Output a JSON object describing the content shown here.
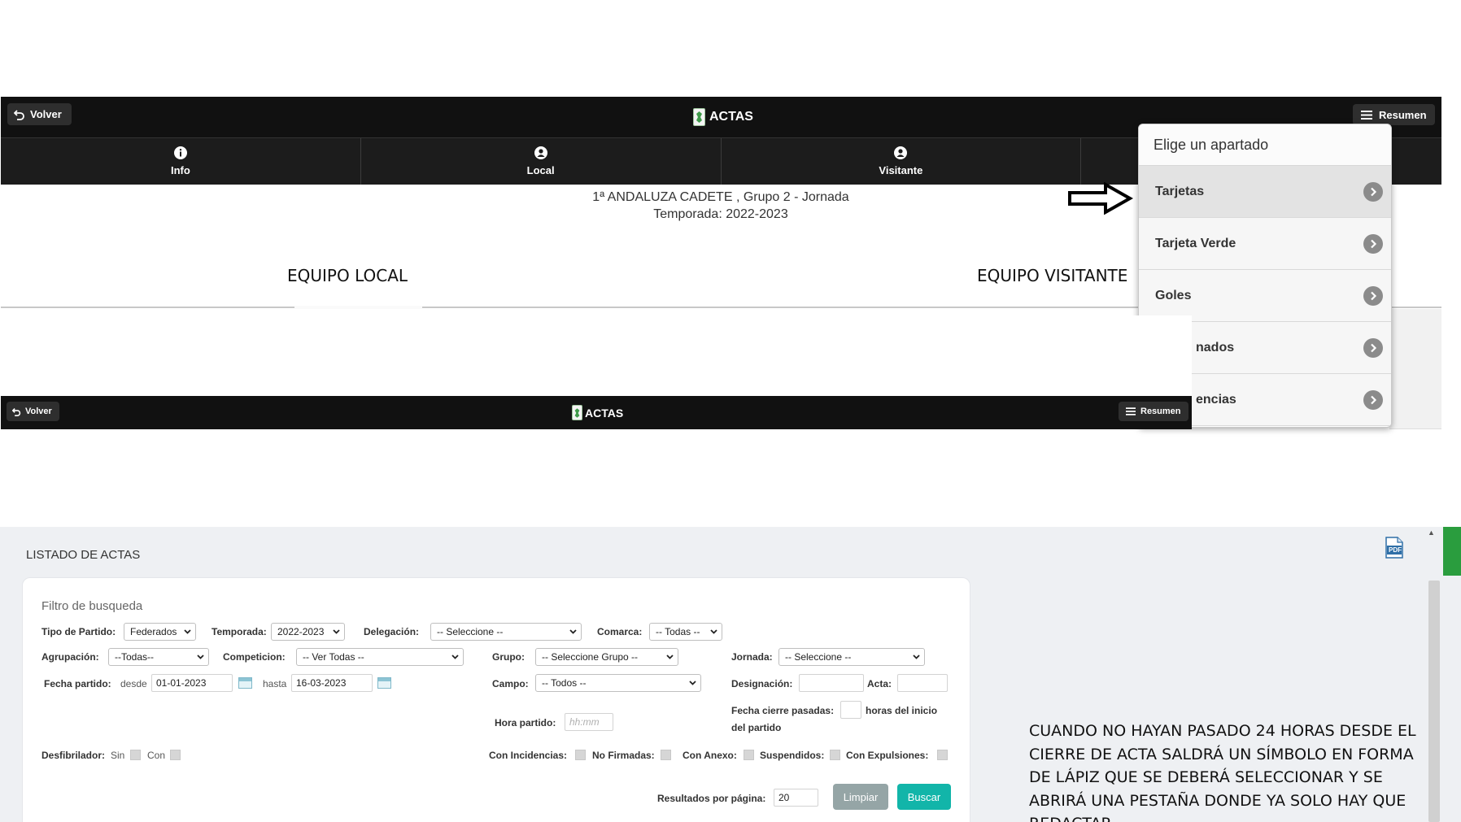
{
  "app": {
    "back_label": "Volver",
    "title": "ACTAS",
    "summary_label": "Resumen"
  },
  "tabs": [
    {
      "label": "Info",
      "icon": "info-icon"
    },
    {
      "label": "Local",
      "icon": "user-icon"
    },
    {
      "label": "Visitante",
      "icon": "user-icon"
    }
  ],
  "match": {
    "competition_line": "1ª ANDALUZA CADETE , Grupo 2 - Jornada",
    "season_line": "Temporada: 2022-2023",
    "home_team_label": "EQUIPO LOCAL",
    "away_team_label": "EQUIPO VISITANTE"
  },
  "dropdown": {
    "header": "Elige un apartado",
    "items": [
      {
        "label": "Tarjetas",
        "active": true
      },
      {
        "label": "Tarjeta Verde",
        "active": false
      },
      {
        "label": "Goles",
        "active": false
      },
      {
        "label": "nados",
        "active": false
      },
      {
        "label": "encias",
        "active": false
      }
    ]
  },
  "second_bar": {
    "back_label": "Volver",
    "title": "ACTAS",
    "summary_label": "Resumen"
  },
  "listing": {
    "title": "LISTADO DE ACTAS",
    "pdf_label": "PDF",
    "filter_title": "Filtro de busqueda",
    "labels": {
      "tipo_partido": "Tipo de Partido:",
      "temporada": "Temporada:",
      "delegacion": "Delegación:",
      "comarca": "Comarca:",
      "agrupacion": "Agrupación:",
      "competicion": "Competicion:",
      "grupo": "Grupo:",
      "jornada": "Jornada:",
      "fecha_partido": "Fecha partido:",
      "desde": "desde",
      "hasta": "hasta",
      "campo": "Campo:",
      "designacion": "Designación:",
      "acta": "Acta:",
      "hora_partido": "Hora partido:",
      "fecha_cierre_1": "Fecha cierre pasadas:",
      "fecha_cierre_2": "horas del inicio",
      "fecha_cierre_3": "del partido",
      "desfibrilador": "Desfibrilador:",
      "sin": "Sin",
      "con": "Con",
      "con_incidencias": "Con Incidencias:",
      "no_firmadas": "No Firmadas:",
      "con_anexo": "Con Anexo:",
      "suspendidos": "Suspendidos:",
      "con_expulsiones": "Con Expulsiones:",
      "resultados_por_pagina": "Resultados por página:"
    },
    "values": {
      "tipo_partido": "Federados",
      "temporada": "2022-2023",
      "delegacion": "-- Seleccione --",
      "comarca": "-- Todas --",
      "agrupacion": "--Todas--",
      "competicion": "-- Ver Todas --",
      "grupo": "-- Seleccione Grupo --",
      "jornada": "-- Seleccione --",
      "fecha_desde": "01-01-2023",
      "fecha_hasta": "16-03-2023",
      "campo": "-- Todos --",
      "hora_placeholder": "hh:mm",
      "resultados": "20"
    },
    "buttons": {
      "limpiar": "Limpiar",
      "buscar": "Buscar"
    }
  },
  "annotation": {
    "text": "CUANDO NO HAYAN PASADO 24 HORAS DESDE EL CIERRE DE ACTA SALDRÁ UN SÍMBOLO EN FORMA DE LÁPIZ QUE SE DEBERÁ SELECCIONAR Y SE ABRIRÁ UNA PESTAÑA DONDE YA SOLO HAY QUE REDACTAR."
  },
  "colors": {
    "dark_bar": "#111111",
    "buscar": "#12b5a9",
    "limpiar": "#95a5a6",
    "green_tab": "#2a9d3e"
  }
}
